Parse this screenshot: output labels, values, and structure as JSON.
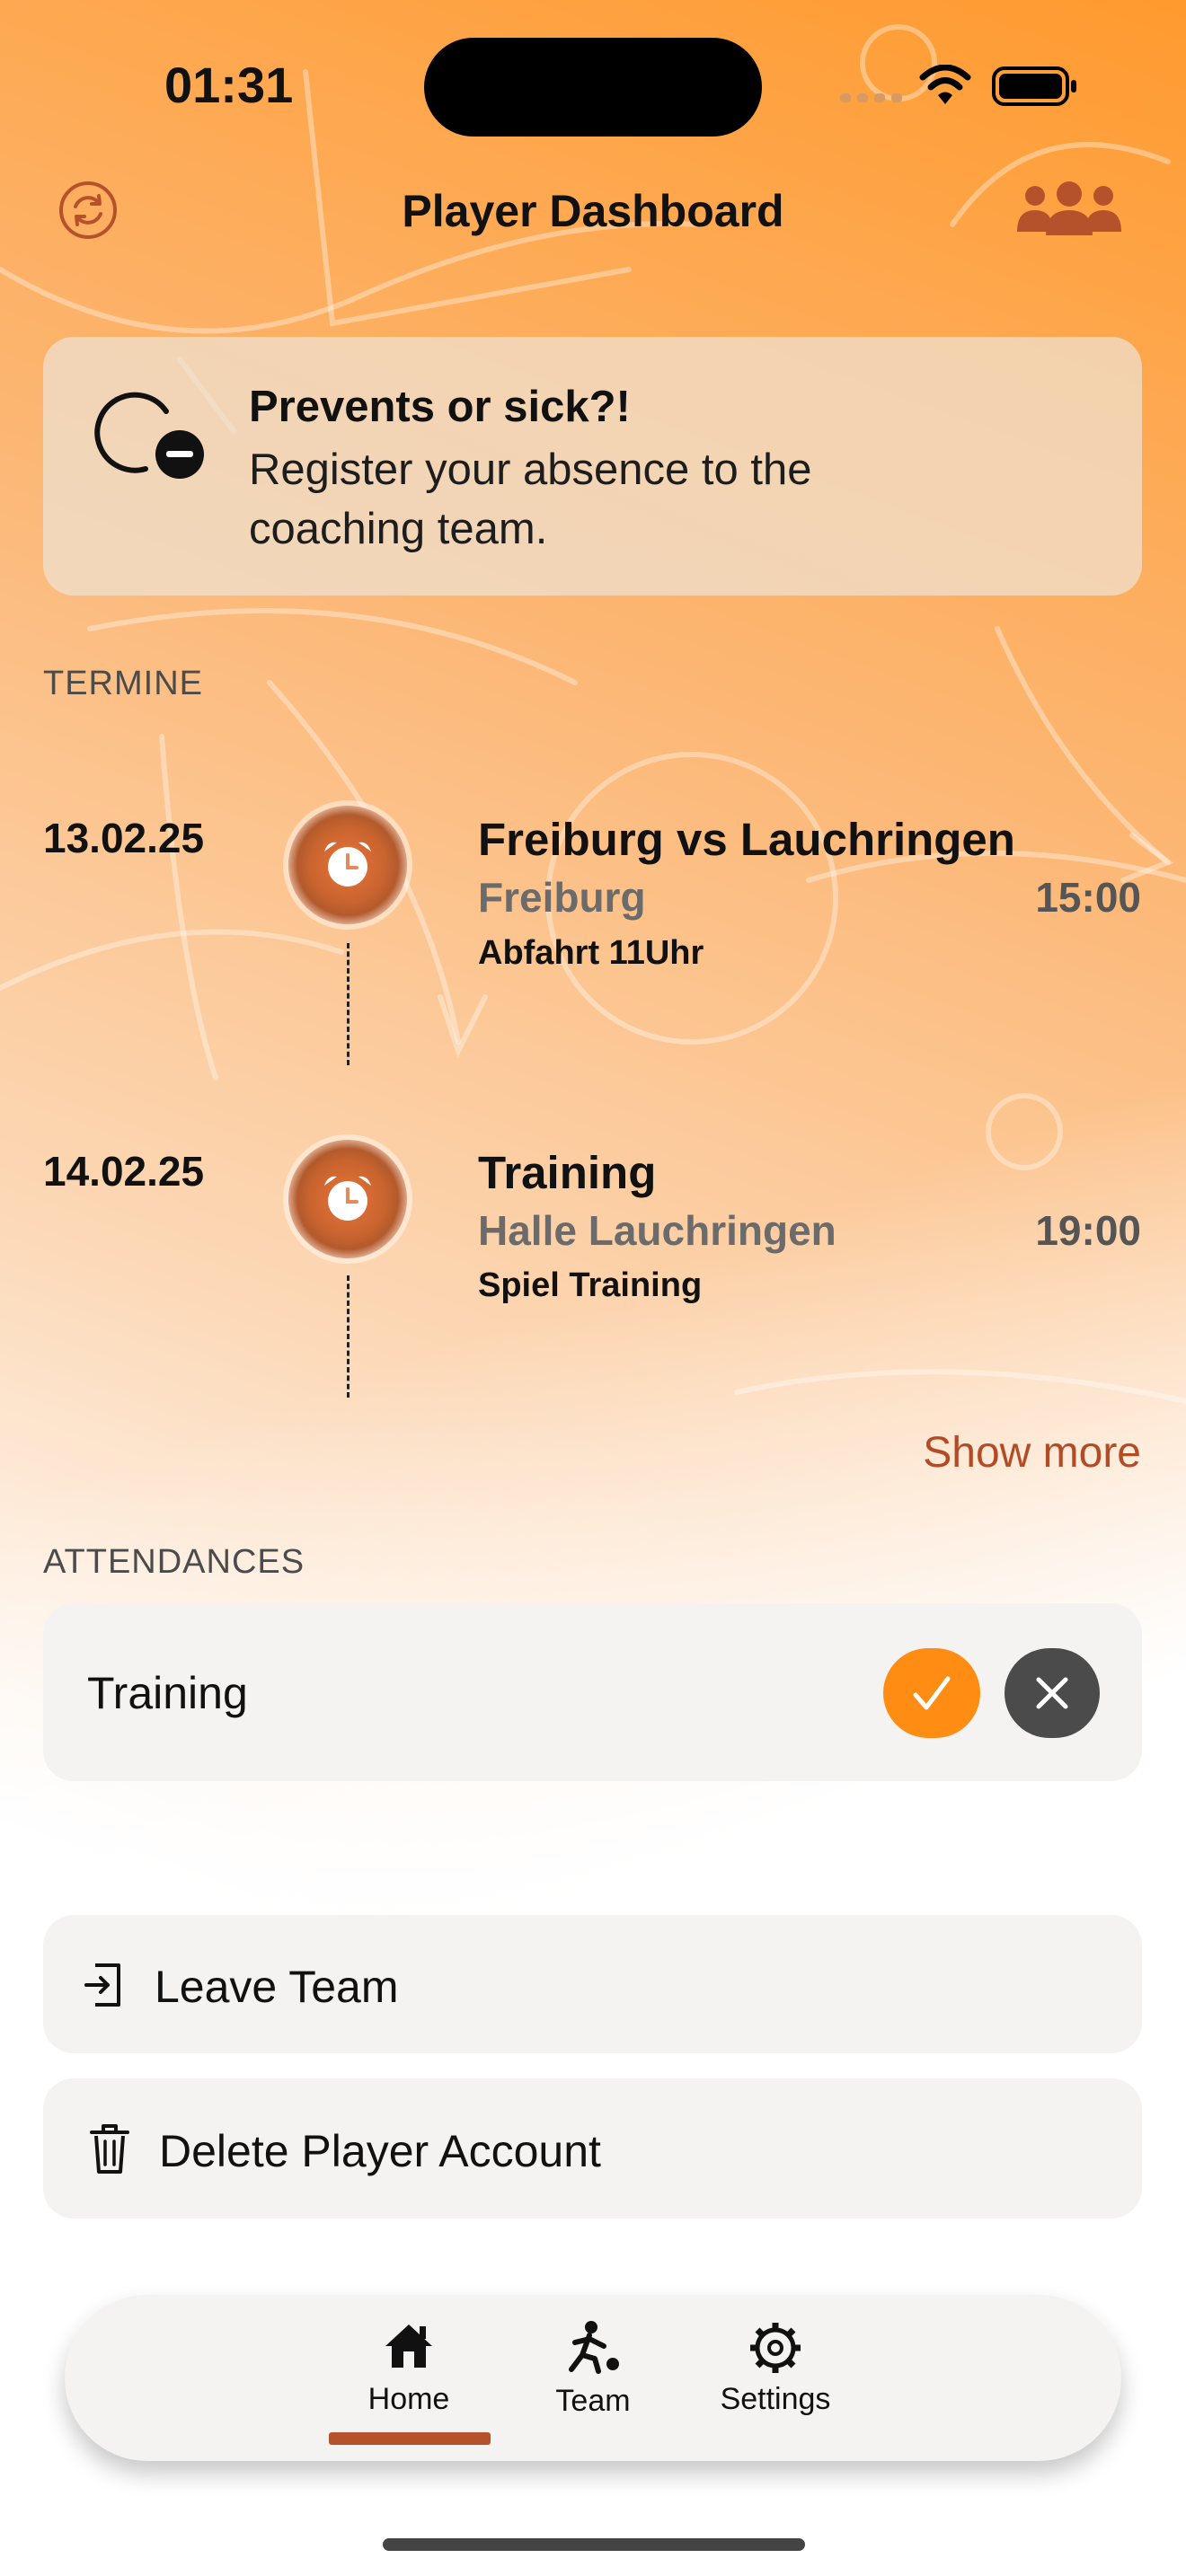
{
  "status_bar": {
    "time": "01:31"
  },
  "header": {
    "title": "Player Dashboard",
    "left_icon": "refresh-icon",
    "right_icon": "group-icon"
  },
  "absence_card": {
    "title": "Prevents or sick?!",
    "text": "Register your absence to the coaching team.",
    "icon": "absence-clock-minus-icon"
  },
  "events_section": {
    "label": "TERMINE",
    "events": [
      {
        "date": "13.02.25",
        "title": "Freiburg vs Lauchringen",
        "location": "Freiburg",
        "time": "15:00",
        "note": "Abfahrt 11Uhr",
        "icon": "alarm-icon"
      },
      {
        "date": "14.02.25",
        "title": "Training",
        "location": "Halle Lauchringen",
        "time": "19:00",
        "note": "Spiel Training",
        "icon": "alarm-icon"
      }
    ],
    "show_more": "Show more"
  },
  "attendances": {
    "label": "ATTENDANCES",
    "items": [
      {
        "name": "Training",
        "accept_icon": "check-icon",
        "decline_icon": "close-icon"
      }
    ]
  },
  "actions": {
    "leave_team": "Leave Team",
    "delete_account": "Delete Player Account"
  },
  "tabbar": {
    "tabs": [
      {
        "label": "Home",
        "icon": "home-icon",
        "selected": true
      },
      {
        "label": "Team",
        "icon": "player-kick-icon",
        "selected": false
      },
      {
        "label": "Settings",
        "icon": "gear-icon",
        "selected": false
      }
    ]
  },
  "colors": {
    "accent": "#ff8c13",
    "brand_brown": "#b5522c",
    "decline": "#4b4b4b"
  }
}
